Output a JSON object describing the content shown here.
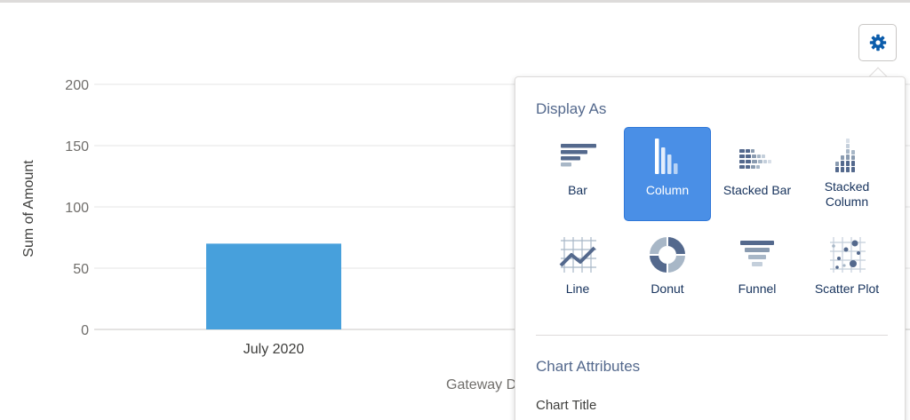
{
  "chart_data": {
    "type": "bar",
    "categories": [
      "July 2020"
    ],
    "values": [
      70
    ],
    "xlabel": "Gateway D",
    "ylabel": "Sum of Amount",
    "ylim": [
      0,
      200
    ],
    "yticks": [
      0,
      50,
      100,
      150,
      200
    ],
    "bar_color": "#47a0dc",
    "grid": true
  },
  "settings_button": {
    "icon": "gear-icon",
    "color": "#0b5cab"
  },
  "panel": {
    "display_as_title": "Display As",
    "options": [
      {
        "label": "Bar",
        "icon": "bar-chart-icon",
        "selected": false
      },
      {
        "label": "Column",
        "icon": "column-chart-icon",
        "selected": true
      },
      {
        "label": "Stacked Bar",
        "icon": "stacked-bar-icon",
        "selected": false
      },
      {
        "label": "Stacked Column",
        "icon": "stacked-column-icon",
        "selected": false
      },
      {
        "label": "Line",
        "icon": "line-chart-icon",
        "selected": false
      },
      {
        "label": "Donut",
        "icon": "donut-chart-icon",
        "selected": false
      },
      {
        "label": "Funnel",
        "icon": "funnel-chart-icon",
        "selected": false
      },
      {
        "label": "Scatter Plot",
        "icon": "scatter-plot-icon",
        "selected": false
      }
    ],
    "chart_attributes_title": "Chart Attributes",
    "chart_title_label": "Chart Title"
  },
  "colors": {
    "accent": "#4a8fe6",
    "icon": "#54698d"
  }
}
